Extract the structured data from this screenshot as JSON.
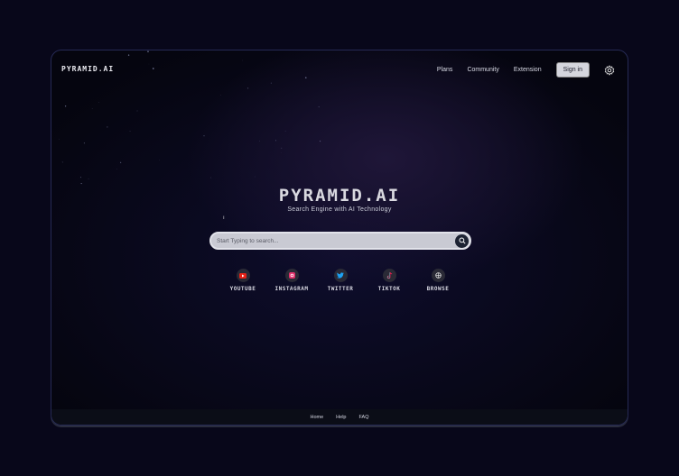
{
  "header": {
    "logo": "PYRAMID.AI",
    "nav": [
      "Plans",
      "Community",
      "Extension"
    ],
    "signin_label": "Sign in"
  },
  "hero": {
    "title": "PYRAMID.AI",
    "subtitle": "Search Engine with AI Technology"
  },
  "search": {
    "placeholder": "Start Typing to search...",
    "value": ""
  },
  "shortcuts": [
    {
      "label": "YOUTUBE",
      "icon": "youtube-icon",
      "color": "#e62117"
    },
    {
      "label": "INSTAGRAM",
      "icon": "instagram-icon",
      "color": "#e1306c"
    },
    {
      "label": "TWITTER",
      "icon": "twitter-icon",
      "color": "#1da1f2"
    },
    {
      "label": "TIKTOK",
      "icon": "tiktok-icon",
      "color": "#ee1d52"
    },
    {
      "label": "BROWSE",
      "icon": "globe-icon",
      "color": "#dddddd"
    }
  ],
  "footer": {
    "links": [
      "Home",
      "Help",
      "FAQ"
    ]
  }
}
